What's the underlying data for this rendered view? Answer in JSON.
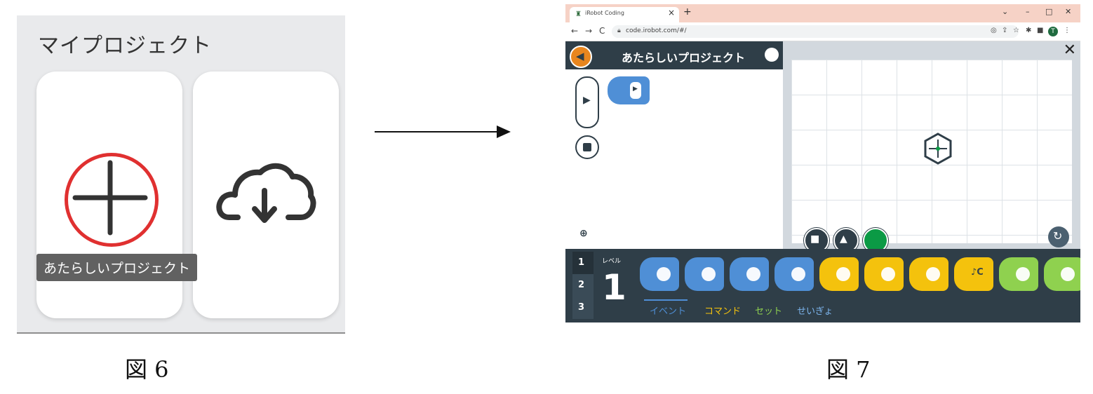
{
  "figure6": {
    "title": "マイプロジェクト",
    "new_project_tooltip": "あたらしいプロジェクト",
    "caption": "図 6"
  },
  "figure7": {
    "caption": "図 7",
    "browser": {
      "tab_title": "iRobot Coding",
      "tab_close": "×",
      "new_tab": "+",
      "url": "code.irobot.com/#/",
      "profile_initial": "T"
    },
    "app": {
      "project_title": "あたらしいプロジェクト",
      "level_label": "レベル",
      "level_number": "1",
      "level_tabs": [
        "1",
        "2",
        "3"
      ],
      "categories": {
        "event": "イベント",
        "command": "コマンド",
        "set": "セット",
        "control": "せいぎょ"
      },
      "palette_blocks": [
        {
          "name": "start",
          "color": "#4f8fd6"
        },
        {
          "name": "bump-sensor",
          "color": "#4f8fd6"
        },
        {
          "name": "light-sensor",
          "color": "#4f8fd6"
        },
        {
          "name": "touch-sensor",
          "color": "#4f8fd6"
        },
        {
          "name": "move",
          "color": "#f4c20d"
        },
        {
          "name": "rotate-left",
          "color": "#f4c20d"
        },
        {
          "name": "rotate-right",
          "color": "#f4c20d"
        },
        {
          "name": "play-note",
          "color": "#f4c20d"
        },
        {
          "name": "set-lights",
          "color": "#8fd14f"
        },
        {
          "name": "set-pen",
          "color": "#8fd14f"
        }
      ],
      "note_block_text": "♪C"
    },
    "colors": {
      "header": "#2f3e48",
      "back_button": "#e8861f",
      "event": "#4f8fd6",
      "command": "#f4c20d",
      "set": "#8fd14f"
    }
  }
}
